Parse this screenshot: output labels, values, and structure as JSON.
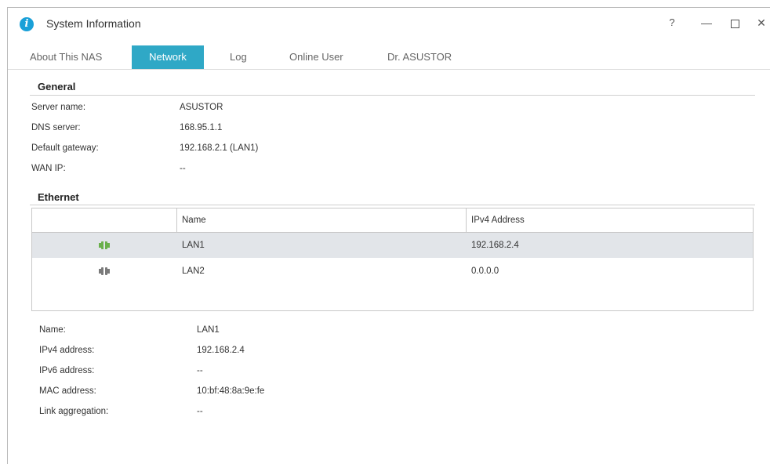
{
  "window": {
    "title": "System Information",
    "controls": {
      "help": "?",
      "minimize": "—",
      "close": "✕"
    }
  },
  "tabs": [
    {
      "label": "About This NAS",
      "active": false
    },
    {
      "label": "Network",
      "active": true
    },
    {
      "label": "Log",
      "active": false
    },
    {
      "label": "Online User",
      "active": false
    },
    {
      "label": "Dr. ASUSTOR",
      "active": false
    }
  ],
  "general": {
    "title": "General",
    "rows": [
      {
        "label": "Server name:",
        "value": "ASUSTOR"
      },
      {
        "label": "DNS server:",
        "value": "168.95.1.1"
      },
      {
        "label": "Default gateway:",
        "value": "192.168.2.1 (LAN1)"
      },
      {
        "label": "WAN IP:",
        "value": "--"
      }
    ]
  },
  "ethernet": {
    "title": "Ethernet",
    "columns": {
      "name": "Name",
      "ipv4": "IPv4 Address"
    },
    "rows": [
      {
        "name": "LAN1",
        "ipv4": "192.168.2.4",
        "status_icon": "port-connected-icon",
        "color": "#6ab04c",
        "selected": true
      },
      {
        "name": "LAN2",
        "ipv4": "0.0.0.0",
        "status_icon": "port-disconnected-icon",
        "color": "#7a7a7a",
        "selected": false
      }
    ]
  },
  "details": {
    "rows": [
      {
        "label": "Name:",
        "value": "LAN1"
      },
      {
        "label": "IPv4 address:",
        "value": "192.168.2.4"
      },
      {
        "label": "IPv6 address:",
        "value": "--"
      },
      {
        "label": "MAC address:",
        "value": "10:bf:48:8a:9e:fe"
      },
      {
        "label": "Link aggregation:",
        "value": "--"
      }
    ]
  },
  "colors": {
    "accent": "#2fa8c6",
    "selected_row": "#e2e5e9",
    "info_icon": "#1aa0d8"
  }
}
